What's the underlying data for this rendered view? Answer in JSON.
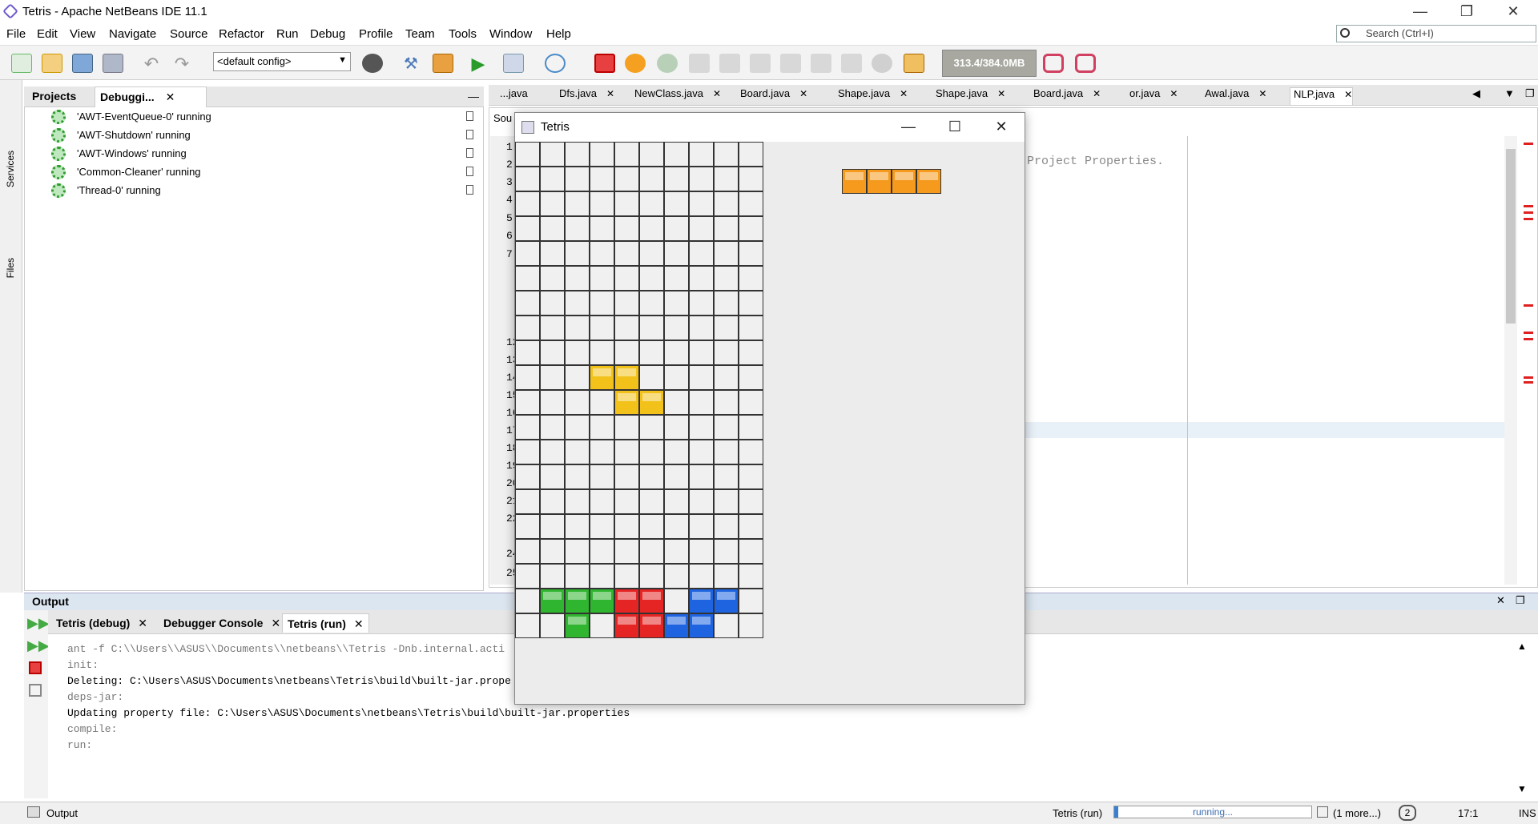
{
  "window": {
    "title": "Tetris - Apache NetBeans IDE 11.1"
  },
  "menu": [
    "File",
    "Edit",
    "View",
    "Navigate",
    "Source",
    "Refactor",
    "Run",
    "Debug",
    "Profile",
    "Team",
    "Tools",
    "Window",
    "Help"
  ],
  "search": {
    "placeholder": "Search (Ctrl+I)"
  },
  "toolbar": {
    "config": "<default config>",
    "memory": "313.4/384.0MB"
  },
  "side_labels": {
    "services": "Services",
    "files": "Files"
  },
  "debug_panel": {
    "tabs": [
      "Projects",
      "Debuggi..."
    ],
    "threads": [
      "'AWT-EventQueue-0' running",
      "'AWT-Shutdown' running",
      "'AWT-Windows' running",
      "'Common-Cleaner' running",
      "'Thread-0' running"
    ]
  },
  "editor": {
    "tabs": [
      "...java",
      "Dfs.java",
      "NewClass.java",
      "Board.java",
      "Shape.java",
      "Shape.java",
      "Board.java",
      "or.java",
      "Awal.java",
      "NLP.java"
    ],
    "partial_tab": "Sou",
    "line_numbers": [
      "1",
      "2",
      "3",
      "4",
      "5",
      "6",
      "7",
      "12",
      "13",
      "14",
      "15",
      "16",
      "17",
      "18",
      "19",
      "20",
      "21",
      "22",
      "24",
      "25"
    ],
    "code_snippet": "Project Properties."
  },
  "output": {
    "title": "Output",
    "tabs": [
      "Tetris (debug)",
      "Debugger Console",
      "Tetris (run)"
    ],
    "active_tab": 2,
    "lines": [
      {
        "text": "ant -f C:\\\\Users\\\\ASUS\\\\Documents\\\\netbeans\\\\Tetris -Dnb.internal.acti",
        "gray": true
      },
      {
        "text": "init:",
        "gray": true
      },
      {
        "text": "Deleting: C:\\Users\\ASUS\\Documents\\netbeans\\Tetris\\build\\built-jar.prope",
        "gray": false
      },
      {
        "text": "deps-jar:",
        "gray": true
      },
      {
        "text": "Updating property file: C:\\Users\\ASUS\\Documents\\netbeans\\Tetris\\build\\built-jar.properties",
        "gray": false
      },
      {
        "text": "compile:",
        "gray": true
      },
      {
        "text": "run:",
        "gray": true
      }
    ]
  },
  "statusbar": {
    "output_label": "Output",
    "task": "Tetris (run)",
    "progress_text": "running...",
    "more": "(1 more...)",
    "badge": "2",
    "position": "17:1",
    "mode": "INS"
  },
  "tetris": {
    "title": "Tetris",
    "cols": 10,
    "rows": 20,
    "colors": {
      "yellow": "#f2c21b",
      "green": "#2fb52f",
      "red": "#e52424",
      "blue": "#1e64e0",
      "orange": "#f59a1c"
    },
    "blocks": [
      {
        "col": 3,
        "row": 9,
        "color": "yellow"
      },
      {
        "col": 4,
        "row": 9,
        "color": "yellow"
      },
      {
        "col": 4,
        "row": 10,
        "color": "yellow"
      },
      {
        "col": 5,
        "row": 10,
        "color": "yellow"
      },
      {
        "col": 1,
        "row": 18,
        "color": "green"
      },
      {
        "col": 2,
        "row": 18,
        "color": "green"
      },
      {
        "col": 3,
        "row": 18,
        "color": "green"
      },
      {
        "col": 4,
        "row": 18,
        "color": "red"
      },
      {
        "col": 5,
        "row": 18,
        "color": "red"
      },
      {
        "col": 7,
        "row": 18,
        "color": "blue"
      },
      {
        "col": 8,
        "row": 18,
        "color": "blue"
      },
      {
        "col": 2,
        "row": 19,
        "color": "green"
      },
      {
        "col": 4,
        "row": 19,
        "color": "red"
      },
      {
        "col": 5,
        "row": 19,
        "color": "red"
      },
      {
        "col": 6,
        "row": 19,
        "color": "blue"
      },
      {
        "col": 7,
        "row": 19,
        "color": "blue"
      }
    ],
    "next_piece": {
      "cells": 4,
      "color": "orange"
    }
  }
}
